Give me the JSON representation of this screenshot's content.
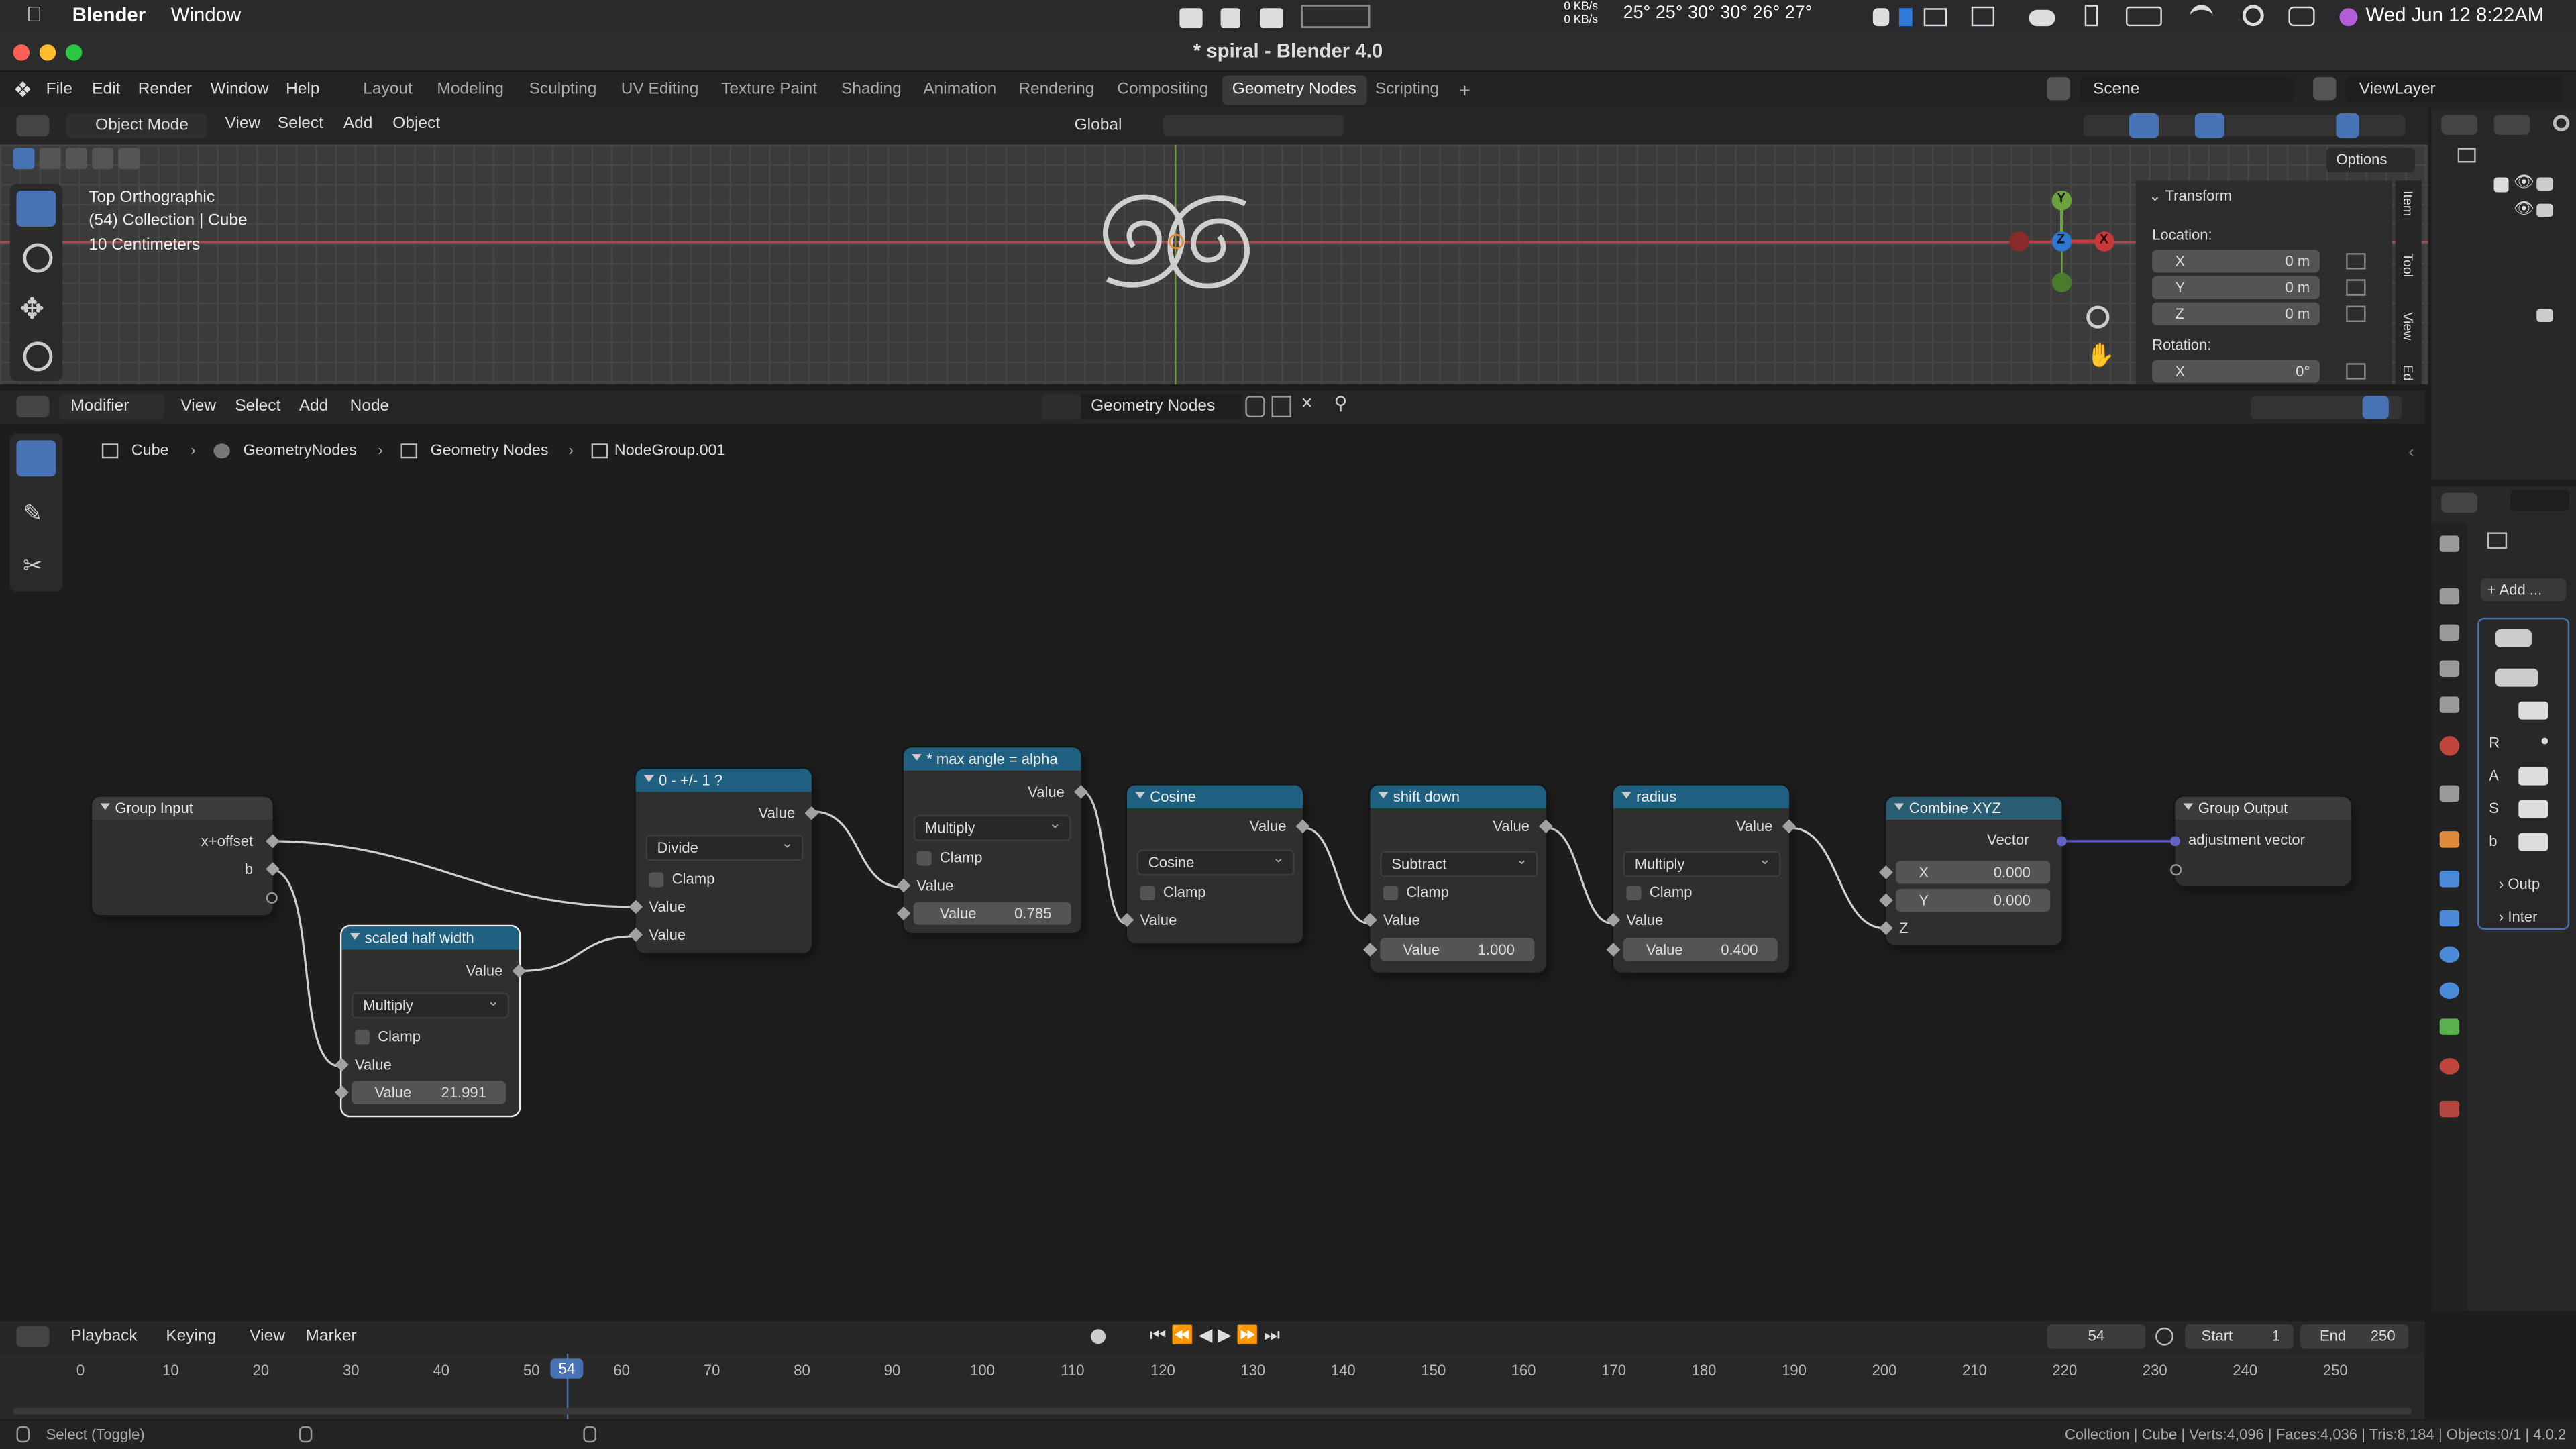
{
  "macbar": {
    "app": "Blender",
    "window": "Window",
    "netstat_top": "0 KB/s",
    "netstat_bottom": "0 KB/s",
    "temps": "25° 25° 30° 30° 26° 27°",
    "datetime": "Wed Jun 12  8:22AM"
  },
  "titlebar": {
    "title": "* spiral - Blender 4.0"
  },
  "topbar": {
    "menus": [
      "File",
      "Edit",
      "Render",
      "Window",
      "Help"
    ],
    "workspaces": [
      "Layout",
      "Modeling",
      "Sculpting",
      "UV Editing",
      "Texture Paint",
      "Shading",
      "Animation",
      "Rendering",
      "Compositing",
      "Geometry Nodes",
      "Scripting"
    ],
    "active_workspace": "Geometry Nodes",
    "scene": "Scene",
    "viewlayer": "ViewLayer"
  },
  "viewport": {
    "mode": "Object Mode",
    "menus": [
      "View",
      "Select",
      "Add",
      "Object"
    ],
    "orientation": "Global",
    "info_line1": "Top Orthographic",
    "info_line2": "(54) Collection | Cube",
    "info_line3": "10 Centimeters",
    "options": "Options",
    "gizmo": {
      "x": "X",
      "y": "Y",
      "z": "Z"
    },
    "npanel": {
      "transform": "Transform",
      "location": "Location:",
      "rotation": "Rotation:",
      "loc_x_label": "X",
      "loc_x": "0 m",
      "loc_y_label": "Y",
      "loc_y": "0 m",
      "loc_z_label": "Z",
      "loc_z": "0 m",
      "rot_x_label": "X",
      "rot_x": "0°",
      "tabs": [
        "Item",
        "Tool",
        "View",
        "Ed"
      ]
    }
  },
  "node_editor": {
    "editor_type": "Modifier",
    "menus": [
      "View",
      "Select",
      "Add",
      "Node"
    ],
    "tree_name": "Geometry Nodes",
    "breadcrumb": [
      "Cube",
      "GeometryNodes",
      "Geometry Nodes",
      "NodeGroup.001"
    ],
    "nodes": {
      "group_input": {
        "title": "Group Input",
        "out1": "x+offset",
        "out2": "b"
      },
      "scaled": {
        "title": "scaled half width",
        "out": "Value",
        "op": "Multiply",
        "clamp": "Clamp",
        "in1": "Value",
        "in2_label": "Value",
        "in2": "21.991"
      },
      "divide": {
        "title": "0 - +/- 1 ?",
        "out": "Value",
        "op": "Divide",
        "clamp": "Clamp",
        "in1": "Value",
        "in2": "Value"
      },
      "maxangle": {
        "title": "* max angle = alpha",
        "out": "Value",
        "op": "Multiply",
        "clamp": "Clamp",
        "in1": "Value",
        "in2_label": "Value",
        "in2": "0.785"
      },
      "cosine": {
        "title": "Cosine",
        "out": "Value",
        "op": "Cosine",
        "clamp": "Clamp",
        "in1": "Value"
      },
      "shift": {
        "title": "shift down",
        "out": "Value",
        "op": "Subtract",
        "clamp": "Clamp",
        "in1": "Value",
        "in2_label": "Value",
        "in2": "1.000"
      },
      "radius": {
        "title": "radius",
        "out": "Value",
        "op": "Multiply",
        "clamp": "Clamp",
        "in1": "Value",
        "in2_label": "Value",
        "in2": "0.400"
      },
      "combine": {
        "title": "Combine XYZ",
        "out": "Vector",
        "x_label": "X",
        "x": "0.000",
        "y_label": "Y",
        "y": "0.000",
        "z": "Z"
      },
      "group_output": {
        "title": "Group Output",
        "in1": "adjustment vector"
      }
    }
  },
  "properties": {
    "add_modifier": "+ Add ...",
    "rows": [
      "R",
      "A",
      "S",
      "b"
    ],
    "items": [
      "Outp",
      "Inter"
    ]
  },
  "timeline": {
    "menus": [
      "Playback",
      "Keying",
      "View",
      "Marker"
    ],
    "current_frame": "54",
    "start_label": "Start",
    "start": "1",
    "end_label": "End",
    "end": "250",
    "ticks": [
      "0",
      "10",
      "20",
      "30",
      "40",
      "50",
      "60",
      "70",
      "80",
      "90",
      "100",
      "110",
      "120",
      "130",
      "140",
      "150",
      "160",
      "170",
      "180",
      "190",
      "200",
      "210",
      "220",
      "230",
      "240",
      "250"
    ]
  },
  "statusbar": {
    "left": "Select (Toggle)",
    "right": "Collection | Cube | Verts:4,096 | Faces:4,036 | Tris:8,184 | Objects:0/1 | 4.0.2"
  },
  "colors": {
    "accent": "#4772b3",
    "node_header": "#1f5f80",
    "vector_socket": "#6363c7",
    "x_axis": "#c93838",
    "y_axis": "#6ba33f"
  }
}
